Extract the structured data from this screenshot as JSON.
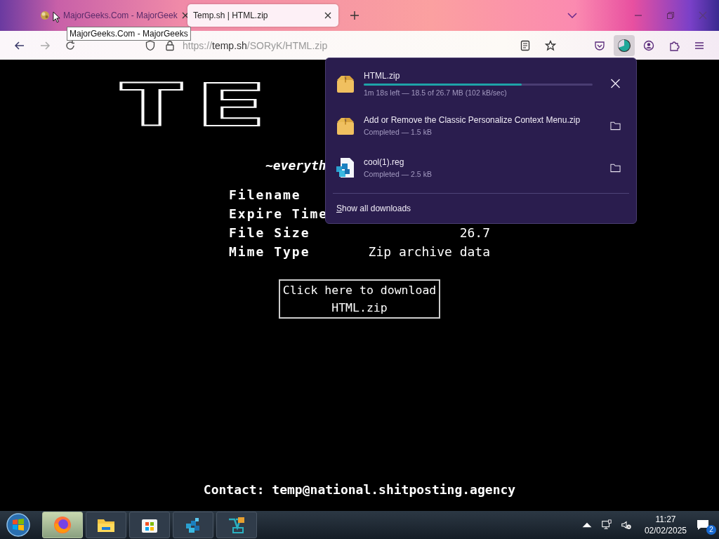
{
  "tabs": [
    {
      "title": "MajorGeeks.Com - MajorGeek",
      "selected": false
    },
    {
      "title": "Temp.sh | HTML.zip",
      "selected": true
    }
  ],
  "tooltip": "MajorGeeks.Com - MajorGeeks",
  "url": {
    "scheme": "https://",
    "host": "temp.sh",
    "path": "/SORyK/HTML.zip"
  },
  "downloads_button_active": true,
  "page": {
    "logo": "TE",
    "tagline": "~everyth",
    "rows": [
      {
        "label": "Filename"
      },
      {
        "label": "Expire Time"
      },
      {
        "label": "File Size",
        "value": "26.7"
      },
      {
        "label": "Mime Type",
        "value": "Zip archive data"
      }
    ],
    "download_button": [
      "Click here to download",
      "HTML.zip"
    ],
    "contact": "Contact: temp@national.shitposting.agency"
  },
  "downloads": [
    {
      "kind": "archive",
      "name": "HTML.zip",
      "status": "1m 18s left — 18.5 of 26.7 MB (102 kB/sec)",
      "level": 0.69
    },
    {
      "kind": "archive",
      "name": "Add or Remove the Classic Personalize Context Menu.zip",
      "status": "Completed — 1.5 kB"
    },
    {
      "kind": "registry",
      "name": "cool(1).reg",
      "status": "Completed — 2.5 kB"
    }
  ],
  "show_all": "Show all downloads",
  "taskbar": {
    "apps": [
      {
        "kind": "firefox",
        "active": true
      },
      {
        "kind": "folder",
        "active": false
      },
      {
        "kind": "store",
        "active": false
      },
      {
        "kind": "cubes",
        "active": false
      },
      {
        "kind": "tool",
        "active": false
      }
    ],
    "time": "11:27",
    "date": "02/02/2025",
    "notifications": "2"
  }
}
